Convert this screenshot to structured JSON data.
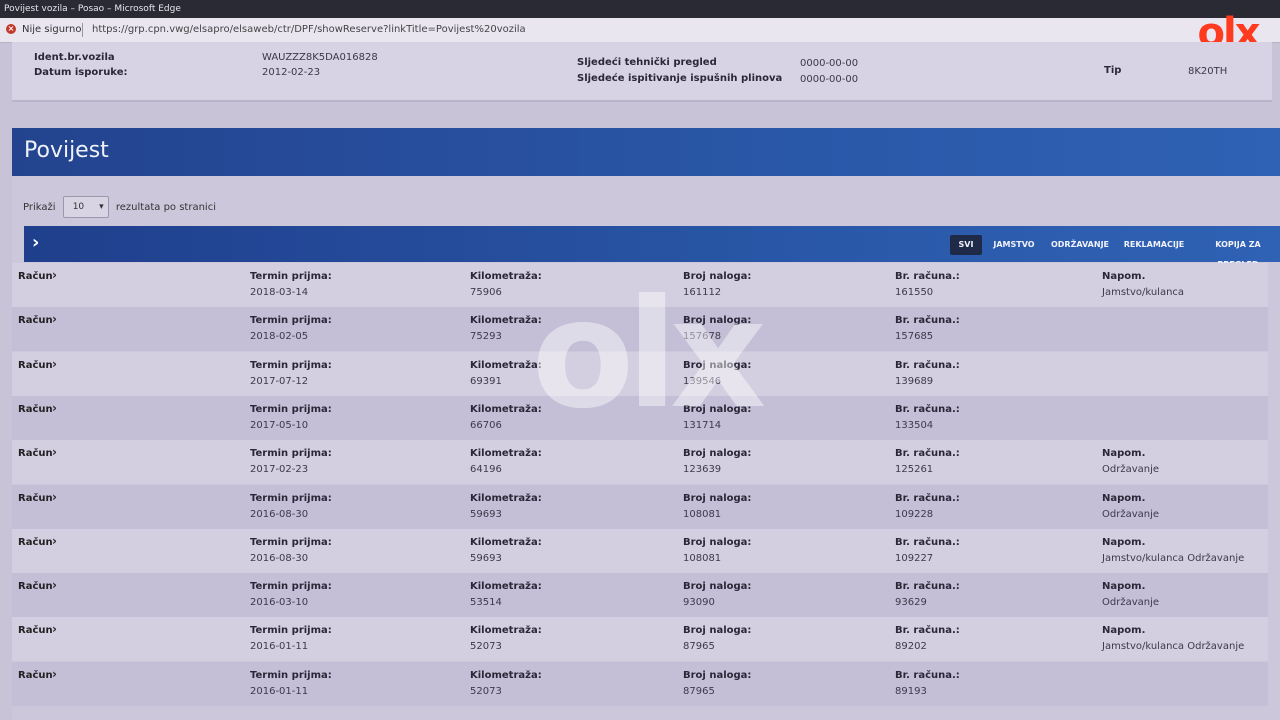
{
  "browser": {
    "window_title": "Povijest vozila – Posao – Microsoft Edge",
    "security_label": "Nije sigurno",
    "url": "https://grp.cpn.vwg/elsapro/elsaweb/ctr/DPF/showReserve?linkTitle=Povijest%20vozila"
  },
  "logo": {
    "text": "olx",
    "color": "#ff3b1f"
  },
  "vehicle": {
    "vin_label": "Ident.br.vozila",
    "vin": "WAUZZZ8K5DA016828",
    "delivery_label": "Datum isporuke:",
    "delivery": "2012-02-23",
    "inspection_label": "Sljedeći tehnički pregled",
    "inspection": "0000-00-00",
    "emission_label": "Sljedeće ispitivanje ispušnih plinova",
    "emission": "0000-00-00",
    "type_label": "Tip",
    "type": "8K20TH"
  },
  "history": {
    "title": "Povijest",
    "show_label": "Prikaži",
    "page_size": "10",
    "per_page_label": "rezultata po stranici",
    "filters": [
      "SVI",
      "JAMSTVO",
      "ODRŽAVANJE",
      "REKLAMACIJE",
      "KOPIJA ZA PREGLED"
    ],
    "labels": {
      "racun": "Račun",
      "termin": "Termin prijma:",
      "km": "Kilometraža:",
      "nalog": "Broj naloga:",
      "br_racuna": "Br. računa.:",
      "napom": "Napom."
    },
    "rows": [
      {
        "termin": "2018-03-14",
        "km": "75906",
        "nalog": "161112",
        "racun": "161550",
        "napom": "Jamstvo/kulanca"
      },
      {
        "termin": "2018-02-05",
        "km": "75293",
        "nalog": "157678",
        "racun": "157685",
        "napom": ""
      },
      {
        "termin": "2017-07-12",
        "km": "69391",
        "nalog": "139546",
        "racun": "139689",
        "napom": ""
      },
      {
        "termin": "2017-05-10",
        "km": "66706",
        "nalog": "131714",
        "racun": "133504",
        "napom": ""
      },
      {
        "termin": "2017-02-23",
        "km": "64196",
        "nalog": "123639",
        "racun": "125261",
        "napom": "Održavanje"
      },
      {
        "termin": "2016-08-30",
        "km": "59693",
        "nalog": "108081",
        "racun": "109228",
        "napom": "Održavanje"
      },
      {
        "termin": "2016-08-30",
        "km": "59693",
        "nalog": "108081",
        "racun": "109227",
        "napom": "Jamstvo/kulanca Održavanje"
      },
      {
        "termin": "2016-03-10",
        "km": "53514",
        "nalog": "93090",
        "racun": "93629",
        "napom": "Održavanje"
      },
      {
        "termin": "2016-01-11",
        "km": "52073",
        "nalog": "87965",
        "racun": "89202",
        "napom": "Jamstvo/kulanca Održavanje"
      },
      {
        "termin": "2016-01-11",
        "km": "52073",
        "nalog": "87965",
        "racun": "89193",
        "napom": ""
      }
    ]
  }
}
